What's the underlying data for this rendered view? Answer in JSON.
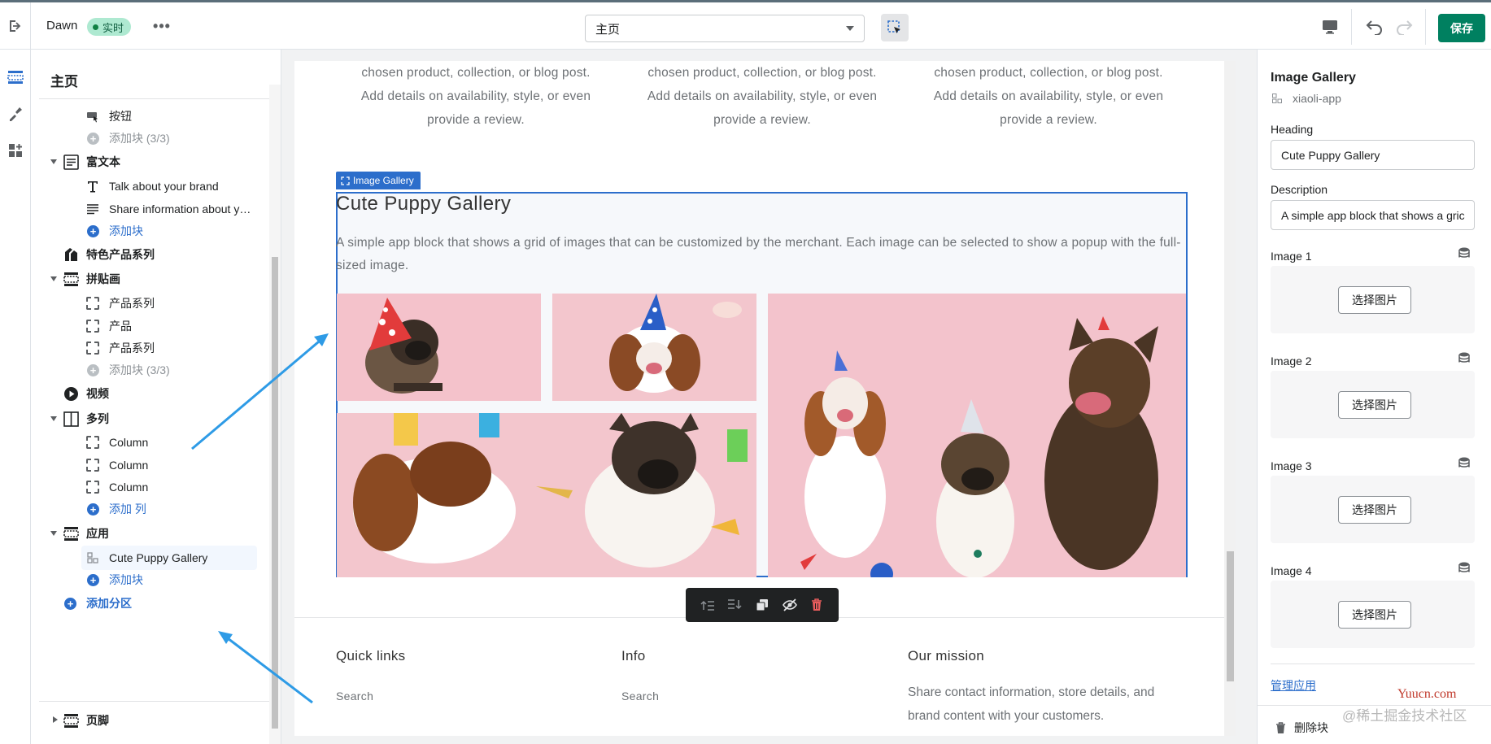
{
  "topbar": {
    "theme_name": "Dawn",
    "live_badge": "实时",
    "more": "•••",
    "page_select": "主页",
    "save": "保存"
  },
  "sidebar": {
    "title": "主页",
    "rows": {
      "button": "按钮",
      "add_block_3": "添加块 (3/3)",
      "rich_text": "富文本",
      "talk": "Talk about your brand",
      "share": "Share information about yo...",
      "add_block": "添加块",
      "featured": "特色产品系列",
      "collage": "拼贴画",
      "collection1": "产品系列",
      "product": "产品",
      "collection2": "产品系列",
      "add_block_3b": "添加块 (3/3)",
      "video": "视频",
      "multicolumn": "多列",
      "column1": "Column",
      "column2": "Column",
      "column3": "Column",
      "add_column": "添加 列",
      "apps": "应用",
      "cute_gallery": "Cute Puppy Gallery",
      "add_block2": "添加块",
      "add_section": "添加分区",
      "footer": "页脚"
    }
  },
  "canvas": {
    "columns_text": [
      "chosen product, collection, or blog post. Add details on availability, style, or even provide a review.",
      "chosen product, collection, or blog post. Add details on availability, style, or even provide a review.",
      "chosen product, collection, or blog post. Add details on availability, style, or even provide a review."
    ],
    "gallery_tag": "Image Gallery",
    "gallery_heading": "Cute Puppy Gallery",
    "gallery_desc": "A simple app block that shows a grid of images that can be customized by the merchant. Each image can be selected to show a popup with the full-sized image.",
    "footer": {
      "quick_links": "Quick links",
      "info": "Info",
      "mission": "Our mission",
      "link1": "Search",
      "link2": "Search",
      "mission_text": "Share contact information, store details, and brand content with your customers."
    }
  },
  "rpanel": {
    "title": "Image Gallery",
    "app": "xiaoli-app",
    "heading_label": "Heading",
    "heading_value": "Cute Puppy Gallery",
    "desc_label": "Description",
    "desc_value": "A simple app block that shows a gric",
    "image1": "Image 1",
    "image2": "Image 2",
    "image3": "Image 3",
    "image4": "Image 4",
    "choose_image": "选择图片",
    "manage_apps": "管理应用",
    "remove_block": "删除块"
  },
  "watermark": {
    "site": "Yuucn.com",
    "community": "@稀土掘金技术社区"
  },
  "colors": {
    "accent": "#2c6ecb",
    "save": "#008060",
    "live": "#aee9d1"
  }
}
